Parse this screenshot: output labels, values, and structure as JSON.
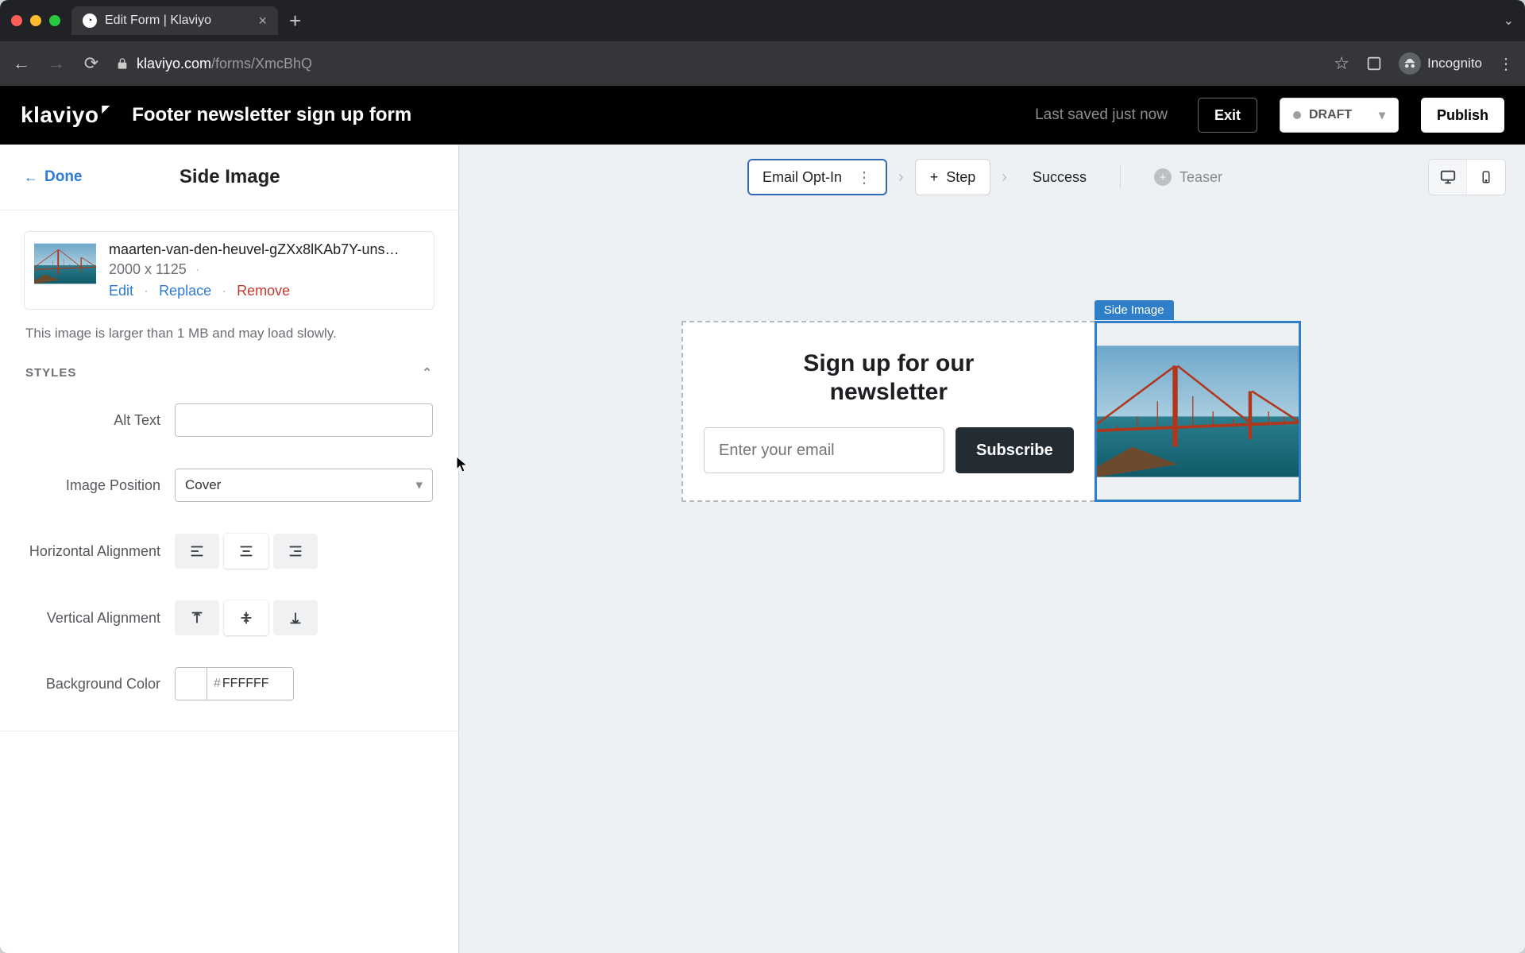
{
  "browser": {
    "tab_title": "Edit Form | Klaviyo",
    "url_host": "klaviyo.com",
    "url_path": "/forms/XmcBhQ",
    "incognito_label": "Incognito"
  },
  "header": {
    "logo_text": "klaviyo",
    "form_title": "Footer newsletter sign up form",
    "last_saved": "Last saved just now",
    "exit_label": "Exit",
    "status_label": "DRAFT",
    "publish_label": "Publish"
  },
  "sidebar": {
    "done_label": "Done",
    "panel_title": "Side Image",
    "image": {
      "filename": "maarten-van-den-heuvel-gZXx8lKAb7Y-uns…",
      "dimensions": "2000 x 1125",
      "edit_label": "Edit",
      "replace_label": "Replace",
      "remove_label": "Remove",
      "warning": "This image is larger than 1 MB and may load slowly."
    },
    "styles_section_label": "STYLES",
    "fields": {
      "alt_text_label": "Alt Text",
      "alt_text_value": "",
      "image_position_label": "Image Position",
      "image_position_value": "Cover",
      "horizontal_alignment_label": "Horizontal Alignment",
      "vertical_alignment_label": "Vertical Alignment",
      "background_color_label": "Background Color",
      "background_color_value": "FFFFFF"
    }
  },
  "canvas_toolbar": {
    "step_emailoptin": "Email Opt-In",
    "add_step_label": "Step",
    "success_label": "Success",
    "teaser_label": "Teaser"
  },
  "form_preview": {
    "headline": "Sign up for our newsletter",
    "email_placeholder": "Enter your email",
    "subscribe_label": "Subscribe",
    "side_image_tag": "Side Image"
  }
}
